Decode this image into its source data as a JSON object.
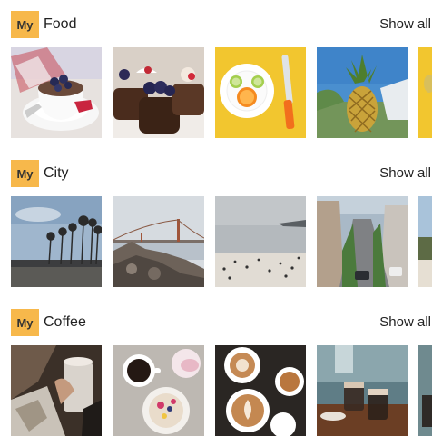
{
  "sections": [
    {
      "badge": "My",
      "title": "Food",
      "show_all": "Show all",
      "photos": [
        {
          "subject": "coffee cup with blueberries",
          "dominant": "#d9d2cc"
        },
        {
          "subject": "chocolate cupcakes with berries",
          "dominant": "#4a2c1d"
        },
        {
          "subject": "plate with citrus slices and knife",
          "dominant": "#f2c62f"
        },
        {
          "subject": "pineapple against blue sky",
          "dominant": "#4a8fcf"
        },
        {
          "subject": "yellow food photo (partially visible)",
          "dominant": "#f2c62f"
        }
      ]
    },
    {
      "badge": "My",
      "title": "City",
      "show_all": "Show all",
      "photos": [
        {
          "subject": "palm trees by the shore",
          "dominant": "#9fb6cd"
        },
        {
          "subject": "golden gate bridge from rocks",
          "dominant": "#c9ced4"
        },
        {
          "subject": "beach with people",
          "dominant": "#d2d2d2"
        },
        {
          "subject": "steep city street",
          "dominant": "#a9b9c7"
        },
        {
          "subject": "city street (partially visible)",
          "dominant": "#a9b9c7"
        }
      ]
    },
    {
      "badge": "My",
      "title": "Coffee",
      "show_all": "Show all",
      "photos": [
        {
          "subject": "hand holding coffee cup",
          "dominant": "#5a4a3c"
        },
        {
          "subject": "coffee and cake on table",
          "dominant": "#bdb8b2"
        },
        {
          "subject": "latte art cups from above",
          "dominant": "#2a2623"
        },
        {
          "subject": "coffee glasses in cafe",
          "dominant": "#5f7d86"
        },
        {
          "subject": "cafe table (partially visible)",
          "dominant": "#5f7d86"
        }
      ]
    }
  ]
}
